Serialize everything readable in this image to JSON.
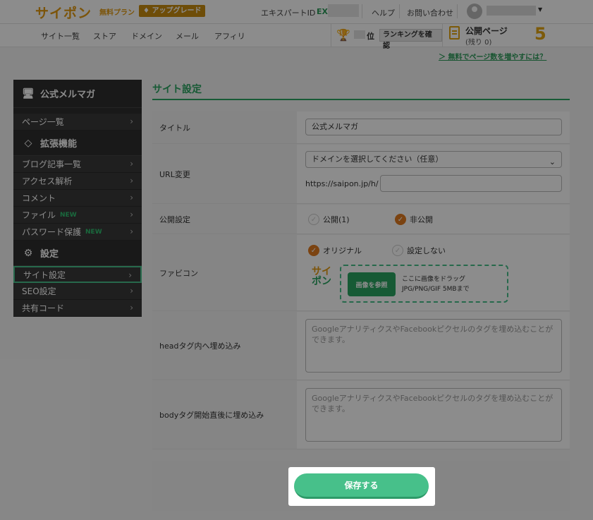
{
  "header": {
    "logo": "サイポン",
    "plan": "無料プラン",
    "upgrade": "アップグレード",
    "expert_label": "エキスパートID",
    "expert_prefix": "EX",
    "help": "ヘルプ",
    "contact": "お問い合わせ"
  },
  "nav": {
    "items": [
      "サイト一覧",
      "ストア",
      "ドメイン",
      "メール",
      "アフィリ"
    ],
    "rank_unit": "位",
    "rank_button": "ランキングを確認",
    "pub_label": "公開ページ",
    "pub_remaining": "(残り 0)",
    "pub_count": "5"
  },
  "help_link": "＞ 無料でページ数を増やすには？",
  "sidebar": {
    "site_name": "公式メルマガ",
    "page_list": "ページ一覧",
    "ext_head": "拡張機能",
    "ext_items": [
      "ブログ記事一覧",
      "アクセス解析",
      "コメント",
      "ファイル",
      "パスワード保護"
    ],
    "new_badge": "NEW",
    "settings_head": "設定",
    "settings_items": [
      "サイト設定",
      "SEO設定",
      "共有コード"
    ]
  },
  "main": {
    "title": "サイト設定",
    "title_label": "タイトル",
    "title_value": "公式メルマガ",
    "url_label": "URL変更",
    "domain_select": "ドメインを選択してください（任意）",
    "url_prefix": "https://saipon.jp/h/",
    "publish_label": "公開設定",
    "publish_options": [
      "公開(1)",
      "非公開"
    ],
    "favicon_label": "ファビコン",
    "favicon_options": [
      "オリジナル",
      "設定しない"
    ],
    "favicon_logo_top": "サイ",
    "favicon_logo_bottom": "ポン",
    "browse_button": "画像を参照",
    "drop_line1": "ここに画像をドラッグ",
    "drop_line2": "JPG/PNG/GIF 5MBまで",
    "head_label": "headタグ内へ埋め込み",
    "head_placeholder": "GoogleアナリティクスやFacebookピクセルのタグを埋め込むことができます。",
    "body_label": "bodyタグ開始直後に埋め込み",
    "body_placeholder": "GoogleアナリティクスやFacebookピクセルのタグを埋め込むことができます。",
    "save_button": "保存する"
  }
}
